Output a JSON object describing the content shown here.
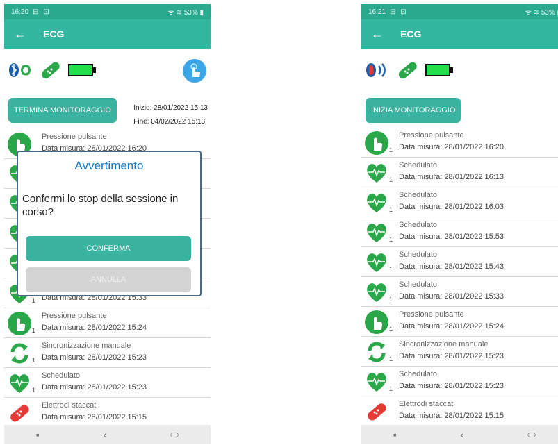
{
  "colors": {
    "teal": "#34b7a1",
    "status": "#2aa98f",
    "green": "#2aa748",
    "blue": "#1a78c2",
    "red": "#e53935"
  },
  "left": {
    "status": {
      "time": "16:20",
      "icons": "⊟ ⊡",
      "system": "ᯤ ≋ 53% ▮"
    },
    "appbar": {
      "back": "←",
      "title": "ECG"
    },
    "button": "TERMINA MONITORAGGIO",
    "start": "Inizio: 28/01/2022 15:13",
    "end": "Fine: 04/02/2022 15:13",
    "items": [
      {
        "icon": "hand",
        "sub": "",
        "title": "Pressione pulsante",
        "date": "Data misura: 28/01/2022 16:20"
      },
      {
        "icon": "heart",
        "sub": "",
        "title": "",
        "date": ""
      },
      {
        "icon": "heart",
        "sub": "",
        "title": "",
        "date": ""
      },
      {
        "icon": "heart",
        "sub": "",
        "title": "",
        "date": ""
      },
      {
        "icon": "heart",
        "sub": "",
        "title": "",
        "date": ""
      },
      {
        "icon": "heart",
        "sub": "1",
        "title": "",
        "date": "Data misura: 28/01/2022 15:33"
      },
      {
        "icon": "hand",
        "sub": "1",
        "title": "Pressione pulsante",
        "date": "Data misura: 28/01/2022 15:24"
      },
      {
        "icon": "sync",
        "sub": "1",
        "title": "Sincronizzazione manuale",
        "date": "Data misura: 28/01/2022 15:23"
      },
      {
        "icon": "heart",
        "sub": "1",
        "title": "Schedulato",
        "date": "Data misura: 28/01/2022 15:23"
      },
      {
        "icon": "electrode",
        "sub": "",
        "title": "Elettrodi staccati",
        "date": "Data misura: 28/01/2022 15:15"
      }
    ],
    "dialog": {
      "title": "Avvertimento",
      "message": "Confermi lo stop della sessione in corso?",
      "confirm": "CONFERMA",
      "cancel": "ANNULLA"
    },
    "nav": {
      "recent": "▪",
      "back": "‹",
      "home": "⬭"
    }
  },
  "right": {
    "status": {
      "time": "16:21",
      "icons": "⊟ ⊡",
      "system": "ᯤ ≋ 53% ▮"
    },
    "appbar": {
      "back": "←",
      "title": "ECG"
    },
    "button": "INIZIA MONITORAGGIO",
    "items": [
      {
        "icon": "hand",
        "sub": "1",
        "title": "Pressione pulsante",
        "date": "Data misura: 28/01/2022 16:20"
      },
      {
        "icon": "heart",
        "sub": "1",
        "title": "Schedulato",
        "date": "Data misura: 28/01/2022 16:13"
      },
      {
        "icon": "heart",
        "sub": "1",
        "title": "Schedulato",
        "date": "Data misura: 28/01/2022 16:03"
      },
      {
        "icon": "heart",
        "sub": "1",
        "title": "Schedulato",
        "date": "Data misura: 28/01/2022 15:53"
      },
      {
        "icon": "heart",
        "sub": "1",
        "title": "Schedulato",
        "date": "Data misura: 28/01/2022 15:43"
      },
      {
        "icon": "heart",
        "sub": "1",
        "title": "Schedulato",
        "date": "Data misura: 28/01/2022 15:33"
      },
      {
        "icon": "hand",
        "sub": "1",
        "title": "Pressione pulsante",
        "date": "Data misura: 28/01/2022 15:24"
      },
      {
        "icon": "sync",
        "sub": "1",
        "title": "Sincronizzazione manuale",
        "date": "Data misura: 28/01/2022 15:23"
      },
      {
        "icon": "heart",
        "sub": "1",
        "title": "Schedulato",
        "date": "Data misura: 28/01/2022 15:23"
      },
      {
        "icon": "electrode",
        "sub": "",
        "title": "Elettrodi staccati",
        "date": "Data misura: 28/01/2022 15:15"
      }
    ],
    "nav": {
      "recent": "▪",
      "back": "‹",
      "home": "⬭"
    }
  }
}
